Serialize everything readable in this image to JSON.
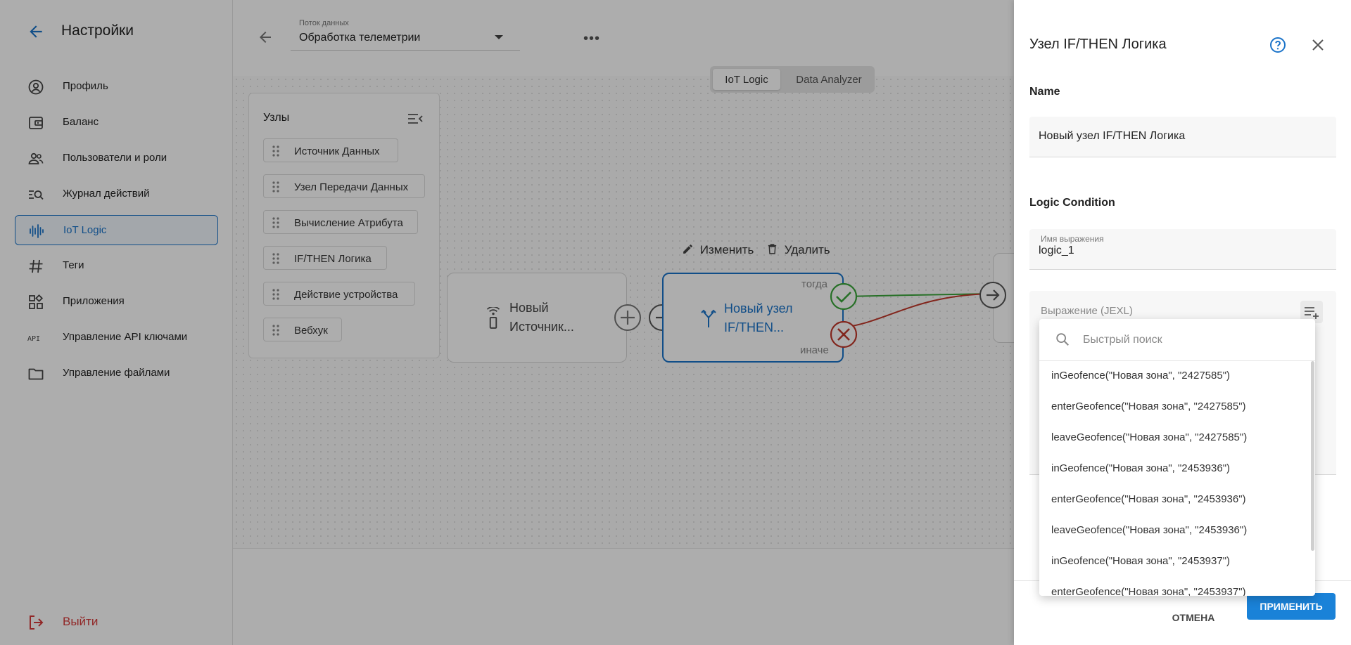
{
  "sidebar": {
    "title": "Настройки",
    "items": [
      {
        "label": "Профиль",
        "icon": "profile-icon"
      },
      {
        "label": "Баланс",
        "icon": "wallet-icon"
      },
      {
        "label": "Пользователи и роли",
        "icon": "users-icon"
      },
      {
        "label": "Журнал действий",
        "icon": "log-search-icon"
      },
      {
        "label": "IoT Logic",
        "icon": "iot-logic-icon",
        "active": true
      },
      {
        "label": "Теги",
        "icon": "hashtag-icon"
      },
      {
        "label": "Приложения",
        "icon": "apps-icon"
      },
      {
        "label": "Управление API ключами",
        "icon": "api-icon"
      },
      {
        "label": "Управление файлами",
        "icon": "folder-icon"
      }
    ],
    "logout": "Выйти",
    "api_badge": "API"
  },
  "topbar": {
    "flow_label": "Поток данных",
    "flow_value": "Обработка телеметрии",
    "more": "•••"
  },
  "modes": {
    "iot_logic": "IoT Logic",
    "data_analyzer": "Data Analyzer"
  },
  "nodes_panel": {
    "title": "Узлы",
    "items": [
      "Источник Данных",
      "Узел Передачи Данных",
      "Вычисление Атрибута",
      "IF/THEN Логика",
      "Действие устройства",
      "Вебхук"
    ]
  },
  "canvas": {
    "source_node": {
      "line1": "Новый",
      "line2": "Источник..."
    },
    "if_node": {
      "line1": "Новый узел",
      "line2": "IF/THEN...",
      "then": "тогда",
      "else": "иначе"
    },
    "edit": "Изменить",
    "delete": "Удалить"
  },
  "drawer": {
    "title": "Узел IF/THEN Логика",
    "name_section": "Name",
    "name_value": "Новый узел IF/THEN Логика",
    "logic_section": "Logic Condition",
    "expr_name_label": "Имя выражения",
    "expr_name_value": "logic_1",
    "expr_placeholder": "Выражение (JEXL)",
    "cancel": "ОТМЕНА",
    "apply": "ПРИМЕНИТЬ"
  },
  "dropdown": {
    "search_placeholder": "Быстрый поиск",
    "items": [
      "inGeofence(\"Новая зона\", \"2427585\")",
      "enterGeofence(\"Новая зона\", \"2427585\")",
      "leaveGeofence(\"Новая зона\", \"2427585\")",
      "inGeofence(\"Новая зона\", \"2453936\")",
      "enterGeofence(\"Новая зона\", \"2453936\")",
      "leaveGeofence(\"Новая зона\", \"2453936\")",
      "inGeofence(\"Новая зона\", \"2453937\")",
      "enterGeofence(\"Новая зона\", \"2453937\")"
    ]
  },
  "colors": {
    "accent": "#1a73c9",
    "apply": "#1a82d8",
    "then": "#3aa53a",
    "else": "#c0392b",
    "logout": "#d63a3a"
  }
}
